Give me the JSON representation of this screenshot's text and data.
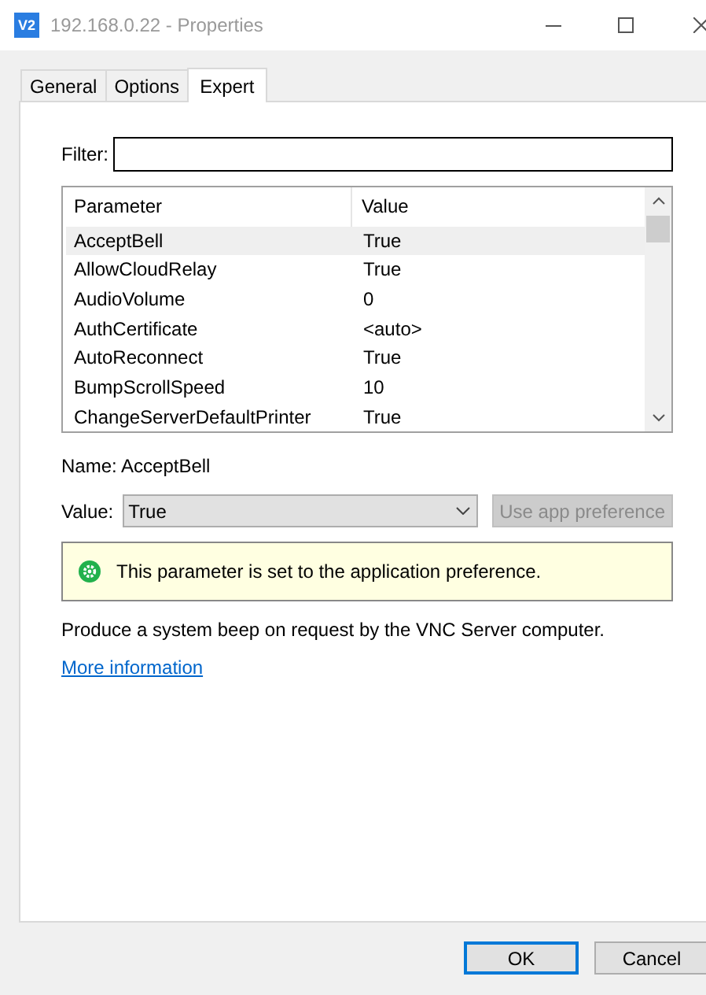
{
  "window": {
    "title": "192.168.0.22 - Properties",
    "app_icon": "V2"
  },
  "tabs": [
    {
      "label": "General",
      "selected": false
    },
    {
      "label": "Options",
      "selected": false
    },
    {
      "label": "Expert",
      "selected": true
    }
  ],
  "filter": {
    "label": "Filter:"
  },
  "table": {
    "columns": [
      "Parameter",
      "Value"
    ],
    "rows": [
      {
        "parameter": "AcceptBell",
        "value": "True",
        "selected": true
      },
      {
        "parameter": "AllowCloudRelay",
        "value": "True",
        "selected": false
      },
      {
        "parameter": "AudioVolume",
        "value": "0",
        "selected": false
      },
      {
        "parameter": "AuthCertificate",
        "value": "<auto>",
        "selected": false
      },
      {
        "parameter": "AutoReconnect",
        "value": "True",
        "selected": false
      },
      {
        "parameter": "BumpScrollSpeed",
        "value": "10",
        "selected": false
      },
      {
        "parameter": "ChangeServerDefaultPrinter",
        "value": "True",
        "selected": false
      }
    ]
  },
  "name_line": "Name: AcceptBell",
  "value_field": {
    "label": "Value:",
    "value": "True"
  },
  "app_preference_button": {
    "label": "Use app preference",
    "disabled": true
  },
  "notice": "This parameter is set to the application preference.",
  "description": "Produce a system beep on request by the VNC Server computer.",
  "link": "More information",
  "buttons": [
    {
      "label": "OK",
      "default": true
    },
    {
      "label": "Cancel",
      "default": false
    }
  ]
}
